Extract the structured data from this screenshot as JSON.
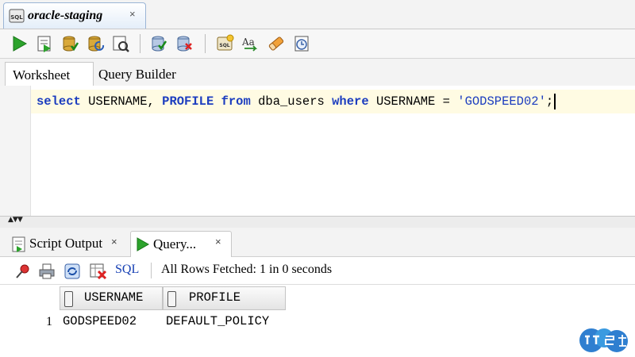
{
  "document_tab": {
    "title": "oracle-staging",
    "close": "×"
  },
  "toolbar": {
    "buttons": [
      "run-statement-icon",
      "run-script-icon",
      "commit-icon",
      "rollback-icon",
      "autotrace-icon",
      "explain-plan-icon",
      "clear-icon",
      "sql-tuning-icon",
      "format-icon",
      "eraser-icon",
      "history-icon"
    ]
  },
  "worksheet_tabs": {
    "worksheet": "Worksheet",
    "query_builder": "Query Builder"
  },
  "editor": {
    "tokens": [
      {
        "t": "select",
        "c": "kw"
      },
      {
        "t": " USERNAME, ",
        "c": "plain"
      },
      {
        "t": "PROFILE",
        "c": "kw"
      },
      {
        "t": " ",
        "c": "plain"
      },
      {
        "t": "from",
        "c": "kw"
      },
      {
        "t": " dba_users ",
        "c": "plain"
      },
      {
        "t": "where",
        "c": "kw"
      },
      {
        "t": " USERNAME = ",
        "c": "plain"
      },
      {
        "t": "'GODSPEED02'",
        "c": "str"
      },
      {
        "t": ";",
        "c": "plain"
      }
    ]
  },
  "output_tabs": {
    "script_output": "Script Output",
    "script_close": "×",
    "query_result": "Query...",
    "query_close": "×"
  },
  "results_toolbar": {
    "sql_link": "SQL",
    "status": "All Rows Fetched: 1 in 0 seconds"
  },
  "grid": {
    "columns": [
      "USERNAME",
      "PROFILE"
    ],
    "rows": [
      {
        "num": "1",
        "cells": [
          "GODSPEED02",
          "DEFAULT_POLICY"
        ]
      }
    ]
  },
  "colors": {
    "keyword": "#1c3dbf",
    "current_line": "#fffbe3",
    "link": "#1640b4"
  }
}
